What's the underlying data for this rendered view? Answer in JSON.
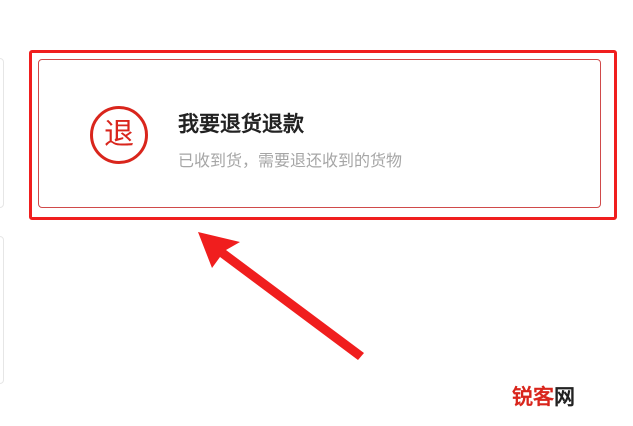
{
  "refund_option": {
    "icon_char": "退",
    "title": "我要退货退款",
    "description": "已收到货，需要退还收到的货物"
  },
  "watermark": {
    "part1": "锐",
    "part2": "客",
    "part3": "网"
  },
  "colors": {
    "accent_red": "#d9251c",
    "highlight_red": "#f01e1e",
    "desc_gray": "#a6a6a6"
  }
}
